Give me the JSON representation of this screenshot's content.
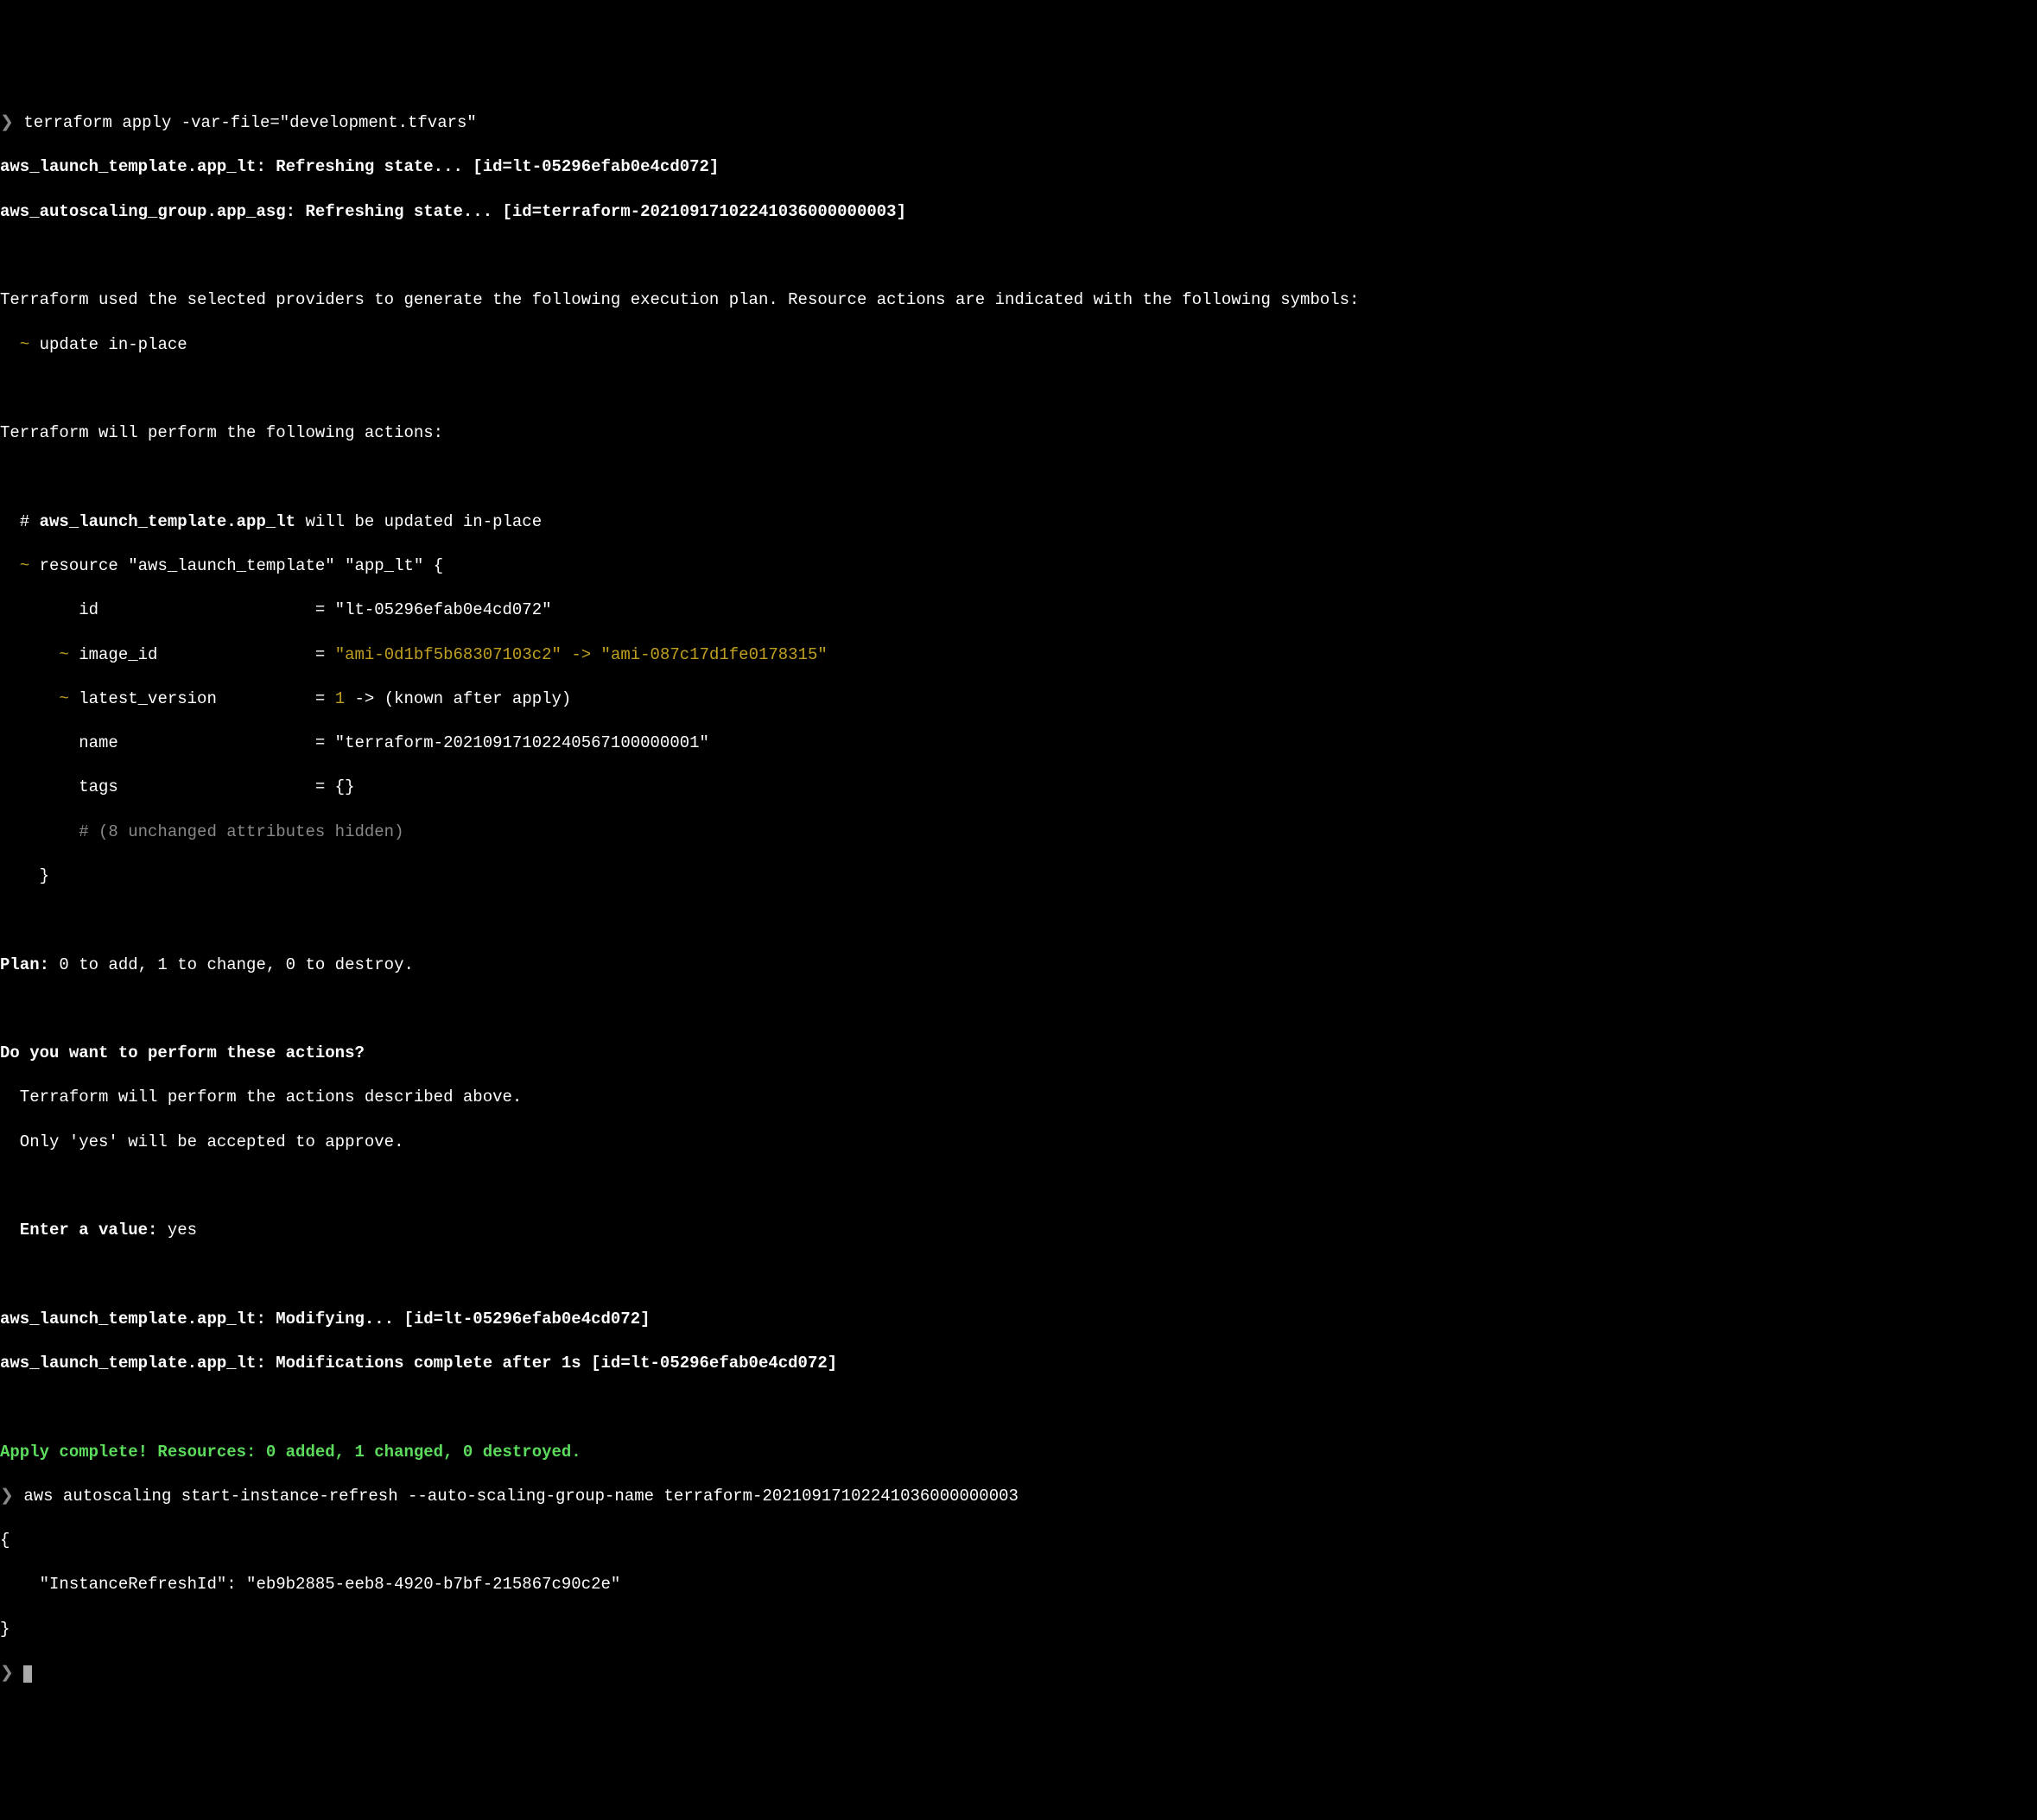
{
  "lines": {
    "l01_prompt": "❯",
    "l01_cmd": " terraform apply -var-file=\"development.tfvars\"",
    "l02": "aws_launch_template.app_lt: Refreshing state... [id=lt-05296efab0e4cd072]",
    "l03": "aws_autoscaling_group.app_asg: Refreshing state... [id=terraform-20210917102241036000000003]",
    "l05": "Terraform used the selected providers to generate the following execution plan. Resource actions are indicated with the following symbols:",
    "l06_sym": "  ~",
    "l06_txt": " update in-place",
    "l08": "Terraform will perform the following actions:",
    "l10a": "  # ",
    "l10b": "aws_launch_template.app_lt",
    "l10c": " will be updated in-place",
    "l11_sym": "  ~",
    "l11_txt": " resource \"aws_launch_template\" \"app_lt\" {",
    "l12": "        id                      = \"lt-05296efab0e4cd072\"",
    "l13_sym": "      ~",
    "l13a": " image_id                = ",
    "l13b": "\"ami-0d1bf5b68307103c2\"",
    "l13c": " -> ",
    "l13d": "\"ami-087c17d1fe0178315\"",
    "l14_sym": "      ~",
    "l14a": " latest_version          = ",
    "l14b": "1",
    "l14c": " -> (known after apply)",
    "l15": "        name                    = \"terraform-20210917102240567100000001\"",
    "l16": "        tags                    = {}",
    "l17": "        # (8 unchanged attributes hidden)",
    "l18": "    }",
    "l20a": "Plan:",
    "l20b": " 0 to add, 1 to change, 0 to destroy.",
    "l22": "Do you want to perform these actions?",
    "l23": "  Terraform will perform the actions described above.",
    "l24": "  Only 'yes' will be accepted to approve.",
    "l26a": "  Enter a value:",
    "l26b": " yes",
    "l28": "aws_launch_template.app_lt: Modifying... [id=lt-05296efab0e4cd072]",
    "l29": "aws_launch_template.app_lt: Modifications complete after 1s [id=lt-05296efab0e4cd072]",
    "l31": "Apply complete! Resources: 0 added, 1 changed, 0 destroyed.",
    "l32_prompt": "❯",
    "l32_cmd": " aws autoscaling start-instance-refresh --auto-scaling-group-name terraform-20210917102241036000000003",
    "l33": "{",
    "l34": "    \"InstanceRefreshId\": \"eb9b2885-eeb8-4920-b7bf-215867c90c2e\"",
    "l35": "}",
    "l36_prompt": "❯"
  }
}
